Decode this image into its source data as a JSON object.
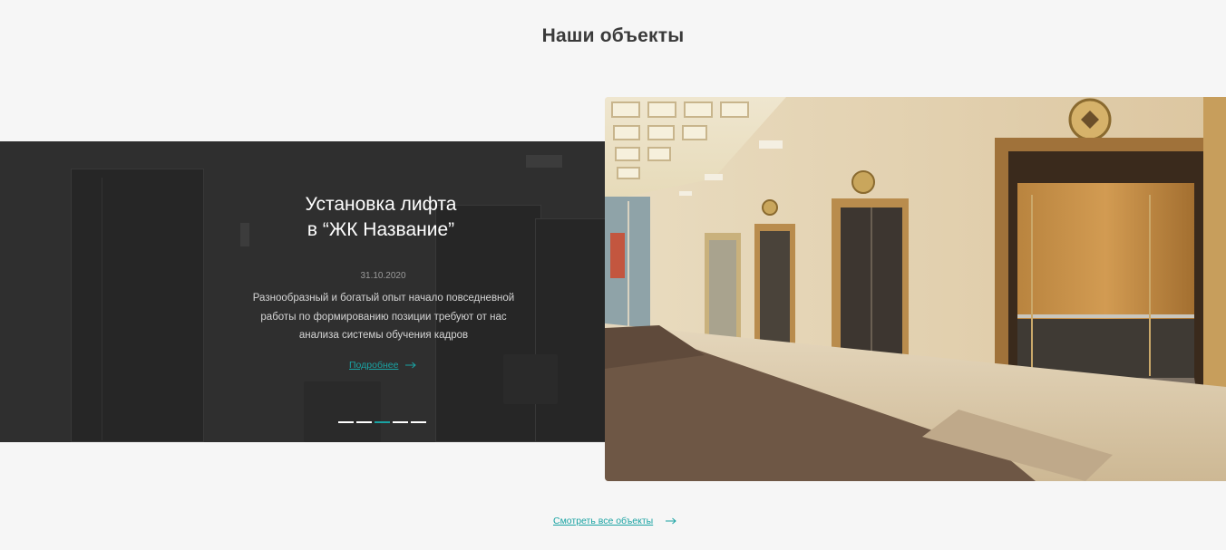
{
  "section": {
    "title": "Наши объекты"
  },
  "slide": {
    "title_line1": "Установка лифта",
    "title_line2": "в “ЖК Название”",
    "date": "31.10.2020",
    "text": "Разнообразный и богатый опыт начало повседневной работы по формированию позиции требуют от нас анализа системы обучения кадров",
    "more_label": "Подробнее",
    "photo_description_icon": "elevator-lobby-photo"
  },
  "pagination": {
    "count": 5,
    "active_index": 2
  },
  "footer": {
    "view_all_label": "Смотреть все объекты"
  },
  "colors": {
    "accent": "#1aa3a3",
    "panel": "#2f2f2f",
    "background": "#f6f6f6",
    "title": "#3a3a3a"
  }
}
